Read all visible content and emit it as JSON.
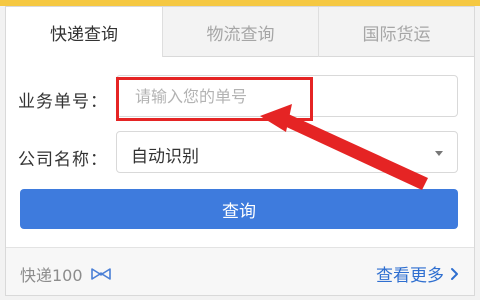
{
  "tabs": [
    {
      "label": "快递查询",
      "active": true
    },
    {
      "label": "物流查询",
      "active": false
    },
    {
      "label": "国际货运",
      "active": false
    }
  ],
  "form": {
    "number_label": "业务单号：",
    "number_placeholder": "请输入您的单号",
    "number_value": "",
    "company_label": "公司名称：",
    "company_value": "自动识别"
  },
  "query_button": {
    "label": "查询"
  },
  "footer": {
    "brand": "快递100",
    "brand_logo_icon": "bow-tie-logo-icon",
    "more_link": "查看更多",
    "more_icon": "chevron-right-icon"
  },
  "colors": {
    "accent": "#3e7bdd",
    "annotation": "#e52424",
    "link": "#2f6fd0",
    "top_edge": "#f5c842"
  }
}
